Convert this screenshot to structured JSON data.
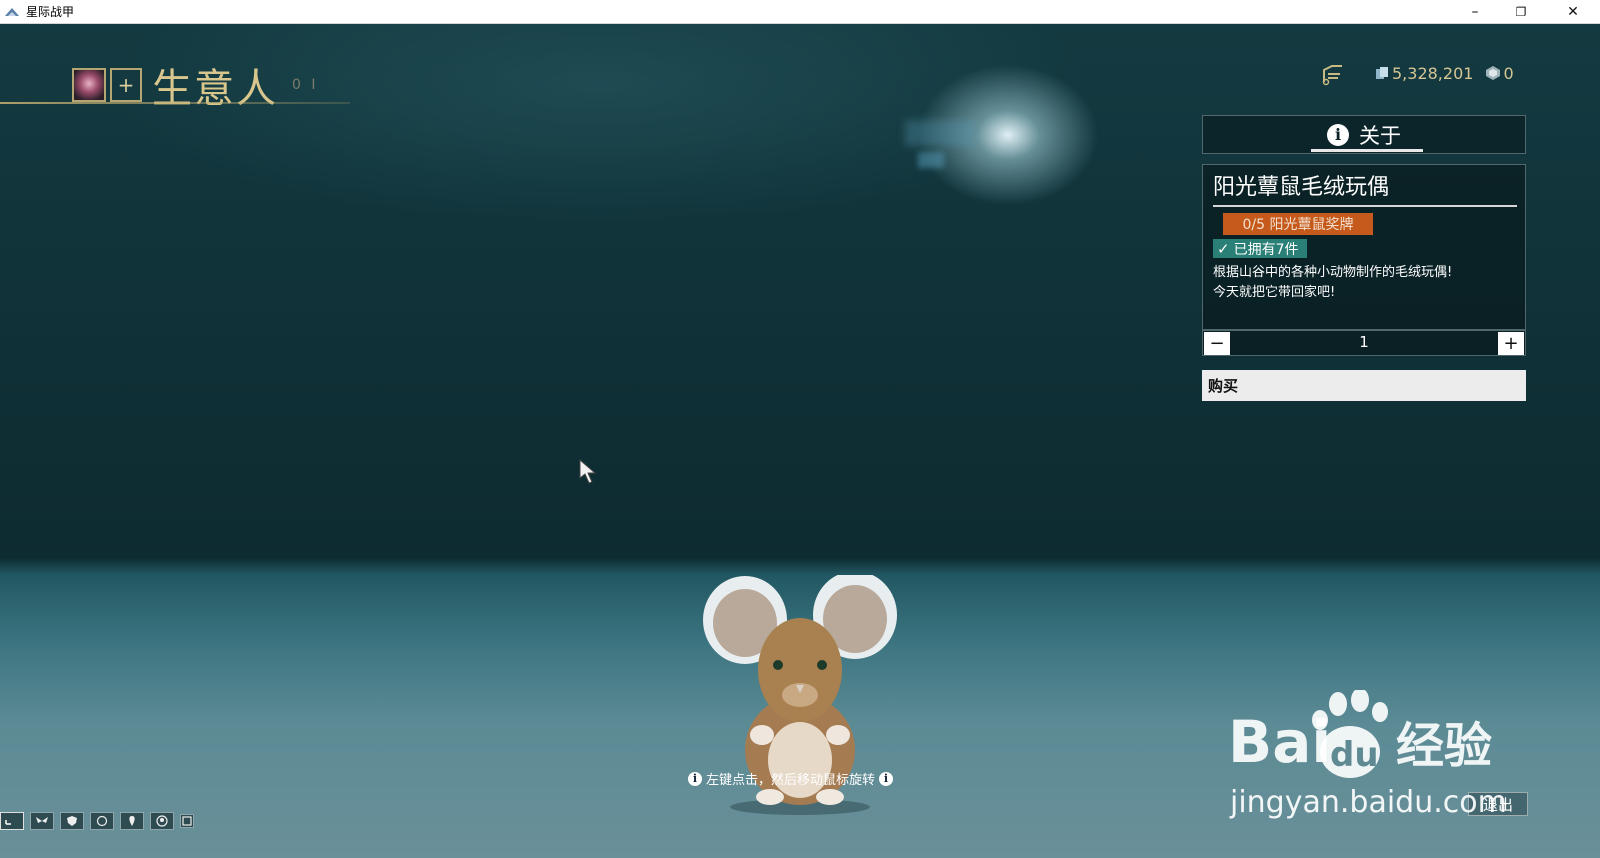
{
  "window": {
    "title": "星际战甲",
    "minimize": "–",
    "restore": "❐",
    "close": "✕"
  },
  "header": {
    "title": "生意人",
    "plus_label": "+",
    "mark": "0 I"
  },
  "currency": {
    "credits": "5,328,201",
    "platinum": "0"
  },
  "about_tab": {
    "label": "关于",
    "info_glyph": "i"
  },
  "item": {
    "name": "阳光蕈鼠毛绒玩偶",
    "medal_progress": "0/5 阳光蕈鼠奖牌",
    "owned": "已拥有7件",
    "check": "✓",
    "description_line1": "根据山谷中的各种小动物制作的毛绒玩偶!",
    "description_line2": "今天就把它带回家吧!"
  },
  "quantity": {
    "minus": "−",
    "value": "1",
    "plus": "+"
  },
  "buy_label": "购买",
  "hint": {
    "text": "左键点击，然后移动鼠标旋转",
    "glyph": "i"
  },
  "exit_label": "退出",
  "watermark": {
    "text": "jingyan.baidu.com"
  },
  "colors": {
    "accent_gold": "#d8c68c",
    "badge_orange": "#c55a1c",
    "badge_owned": "#2a7f76"
  }
}
